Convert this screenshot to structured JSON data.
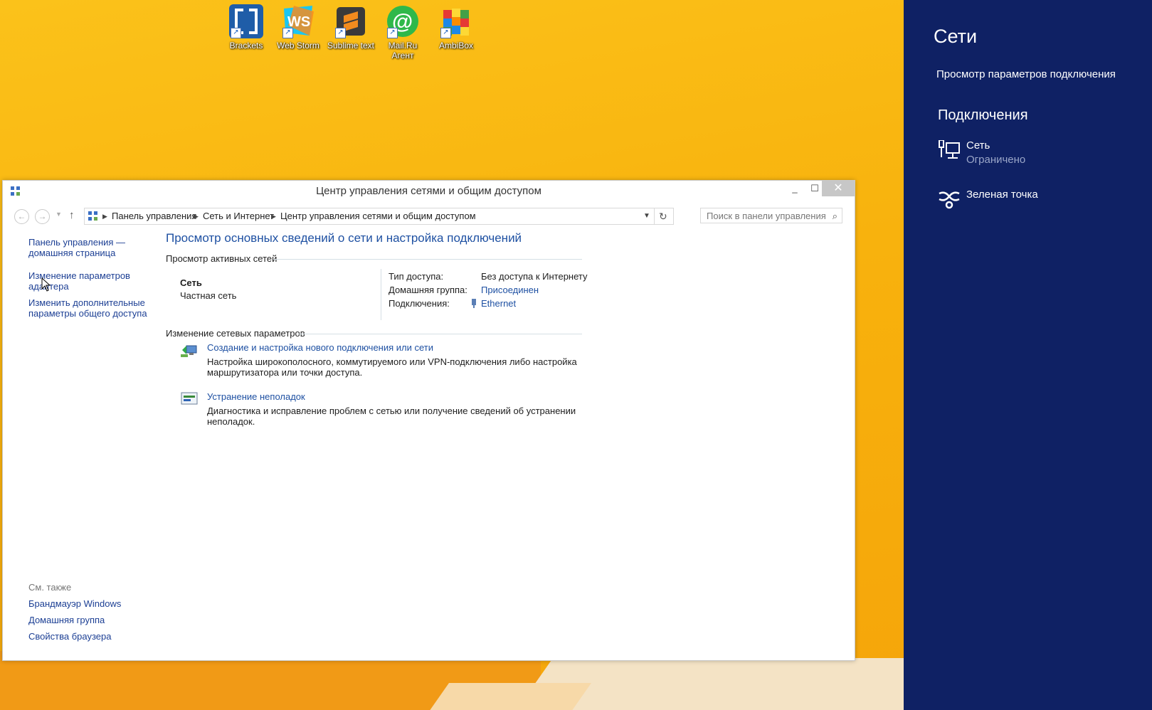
{
  "desktop": {
    "icons": [
      {
        "label": "Brackets",
        "icon": "brackets-icon"
      },
      {
        "label": "Web Storm",
        "icon": "webstorm-icon"
      },
      {
        "label": "Sublime text",
        "icon": "sublime-text-icon"
      },
      {
        "label": "Mail.Ru Агент",
        "icon": "mailru-agent-icon"
      },
      {
        "label": "AmbiBox",
        "icon": "ambibox-icon"
      }
    ]
  },
  "window": {
    "title": "Центр управления сетями и общим доступом",
    "breadcrumb": [
      "Панель управления",
      "Сеть и Интернет",
      "Центр управления сетями и общим доступом"
    ],
    "search_placeholder": "Поиск в панели управления",
    "sidebar": {
      "links": [
        "Панель управления —",
        "домашняя страница",
        "Изменение параметров",
        "адаптера",
        "Изменить дополнительные",
        "параметры общего доступа"
      ],
      "see_also_header": "См. также",
      "see_also": [
        "Брандмауэр Windows",
        "Домашняя группа",
        "Свойства браузера"
      ]
    },
    "main": {
      "heading": "Просмотр основных сведений о сети и настройка подключений",
      "active_networks_header": "Просмотр активных сетей",
      "network_name": "Сеть",
      "network_type": "Частная сеть",
      "access_type_label": "Тип доступа:",
      "access_type_value": "Без доступа к Интернету",
      "homegroup_label": "Домашняя группа:",
      "homegroup_value": "Присоединен",
      "connections_label": "Подключения:",
      "connections_value": "Ethernet",
      "change_settings_header": "Изменение сетевых параметров",
      "tasks": [
        {
          "title": "Создание и настройка нового подключения или сети",
          "desc1": "Настройка широкополосного, коммутируемого или VPN-подключения либо настройка",
          "desc2": "маршрутизатора или точки доступа."
        },
        {
          "title": "Устранение неполадок",
          "desc1": "Диагностика и исправление проблем с сетью или получение сведений об устранении",
          "desc2": "неполадок."
        }
      ]
    }
  },
  "pane": {
    "title": "Сети",
    "view_settings": "Просмотр параметров подключения",
    "connections_header": "Подключения",
    "networks": [
      {
        "name": "Сеть",
        "status": "Ограничено",
        "icon": "wired-network-icon"
      },
      {
        "name": "Зеленая точка",
        "status": "",
        "icon": "mobile-hotspot-icon"
      }
    ]
  },
  "colors": {
    "pane_bg": "#0f2164",
    "link": "#1e50a2",
    "desktop": "#f8b20d"
  }
}
